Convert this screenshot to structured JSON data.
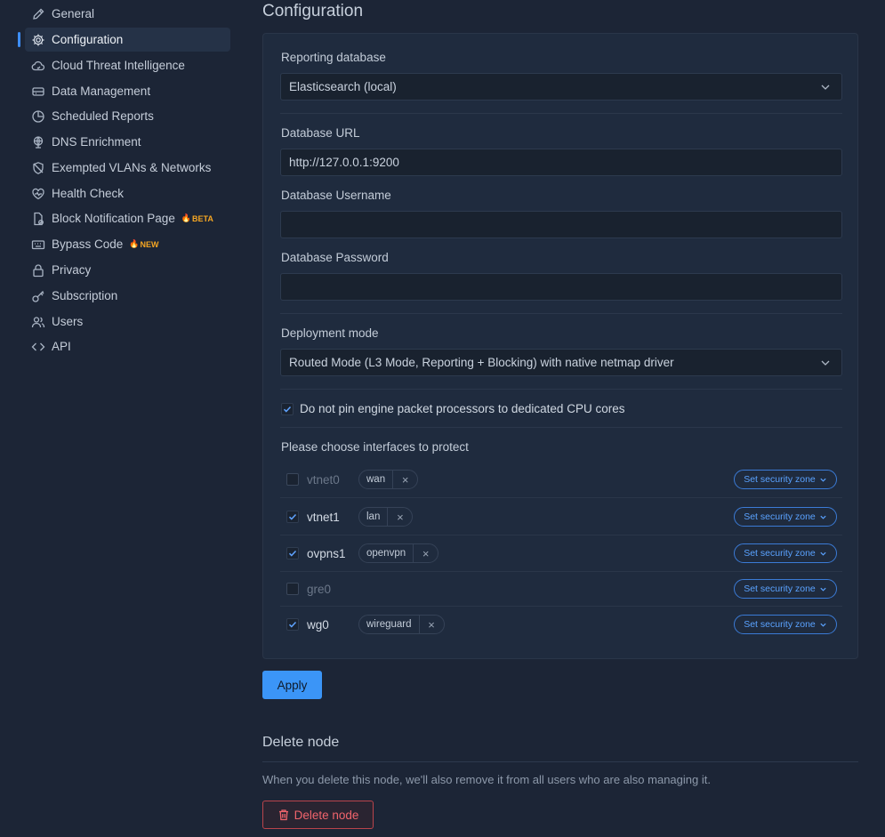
{
  "sidebar": {
    "items": [
      {
        "label": "General",
        "icon": "pencil-icon"
      },
      {
        "label": "Configuration",
        "icon": "gear-icon",
        "active": true
      },
      {
        "label": "Cloud Threat Intelligence",
        "icon": "cloud-icon"
      },
      {
        "label": "Data Management",
        "icon": "database-icon"
      },
      {
        "label": "Scheduled Reports",
        "icon": "pie-chart-icon"
      },
      {
        "label": "DNS Enrichment",
        "icon": "globe-icon"
      },
      {
        "label": "Exempted VLANs & Networks",
        "icon": "shield-off-icon"
      },
      {
        "label": "Health Check",
        "icon": "heart-icon"
      },
      {
        "label": "Block Notification Page",
        "icon": "file-icon",
        "badge": "BETA"
      },
      {
        "label": "Bypass Code",
        "icon": "keyboard-icon",
        "badge": "NEW"
      },
      {
        "label": "Privacy",
        "icon": "lock-icon"
      },
      {
        "label": "Subscription",
        "icon": "key-icon"
      },
      {
        "label": "Users",
        "icon": "users-icon"
      },
      {
        "label": "API",
        "icon": "code-icon"
      }
    ]
  },
  "page": {
    "title": "Configuration"
  },
  "config": {
    "reporting_db_label": "Reporting database",
    "reporting_db_value": "Elasticsearch (local)",
    "db_url_label": "Database URL",
    "db_url_value": "http://127.0.0.1:9200",
    "db_username_label": "Database Username",
    "db_username_value": "",
    "db_password_label": "Database Password",
    "db_password_value": "",
    "deployment_label": "Deployment mode",
    "deployment_value": "Routed Mode (L3 Mode, Reporting + Blocking) with native netmap driver",
    "pin_label": "Do not pin engine packet processors to dedicated CPU cores",
    "pin_checked": true,
    "interfaces_label": "Please choose interfaces to protect",
    "zone_button_label": "Set security zone",
    "interfaces": [
      {
        "name": "vtnet0",
        "checked": false,
        "tag": "wan"
      },
      {
        "name": "vtnet1",
        "checked": true,
        "tag": "lan"
      },
      {
        "name": "ovpns1",
        "checked": true,
        "tag": "openvpn"
      },
      {
        "name": "gre0",
        "checked": false,
        "tag": ""
      },
      {
        "name": "wg0",
        "checked": true,
        "tag": "wireguard"
      }
    ],
    "apply_label": "Apply"
  },
  "delete": {
    "title": "Delete node",
    "description": "When you delete this node, we'll also remove it from all users who are also managing it.",
    "button_label": "Delete node"
  },
  "colors": {
    "accent": "#3b95f7",
    "danger": "#f0646c",
    "background": "#1c2536",
    "card": "#1f2b3e"
  }
}
